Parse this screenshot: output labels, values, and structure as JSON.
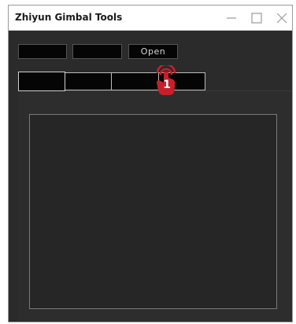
{
  "window": {
    "title": "Zhiyun Gimbal Tools"
  },
  "toolbar": {
    "button1_label": "",
    "button2_label": "",
    "open_label": "Open"
  },
  "tabs": [
    {
      "label": ""
    },
    {
      "label": ""
    },
    {
      "label": ""
    },
    {
      "label": ""
    }
  ],
  "annotation": {
    "step_number": "1",
    "color": "#c8202a"
  },
  "colors": {
    "window_bg": "#2b2b2b",
    "button_bg": "#050505",
    "titlebar_bg": "#ffffff"
  },
  "icons": {
    "minimize": "minimize-icon",
    "maximize": "maximize-icon",
    "close": "close-icon",
    "click": "click-pointer-icon"
  }
}
